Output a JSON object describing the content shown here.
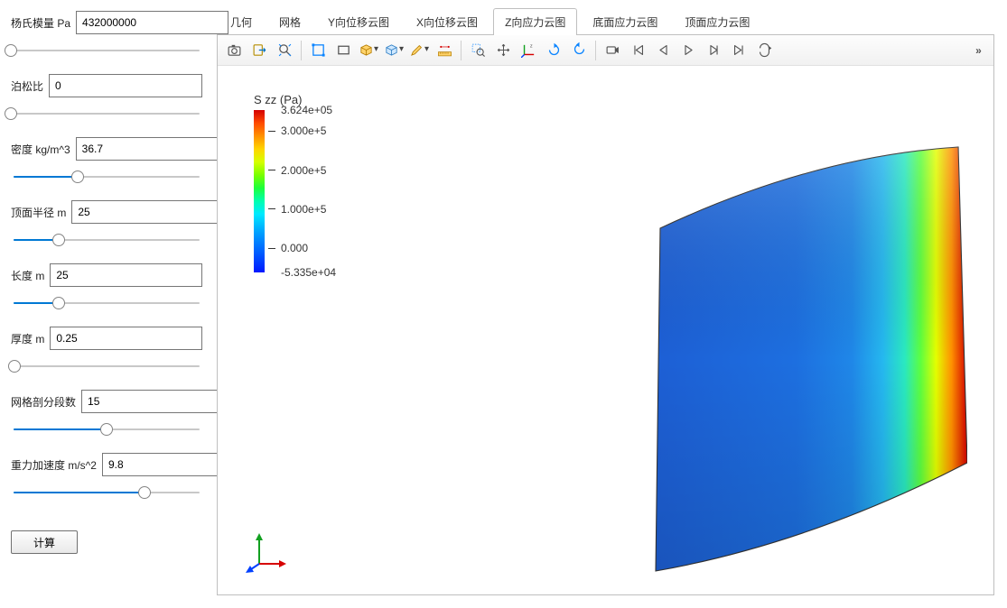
{
  "params": [
    {
      "id": "youngs",
      "label": "杨氏模量 Pa",
      "value": "432000000",
      "pct": 0
    },
    {
      "id": "poisson",
      "label": "泊松比",
      "value": "0",
      "pct": 0
    },
    {
      "id": "density",
      "label": "密度 kg/m^3",
      "value": "36.7",
      "pct": 35
    },
    {
      "id": "radius",
      "label": "顶面半径 m",
      "value": "25",
      "pct": 25
    },
    {
      "id": "length",
      "label": "长度 m",
      "value": "25",
      "pct": 25
    },
    {
      "id": "thick",
      "label": "厚度 m",
      "value": "0.25",
      "pct": 2
    },
    {
      "id": "mesh",
      "label": "网格剖分段数",
      "value": "15",
      "pct": 50
    },
    {
      "id": "grav",
      "label": "重力加速度 m/s^2",
      "value": "9.8",
      "pct": 70
    }
  ],
  "compute_btn": "计算",
  "tabs": [
    {
      "id": "geom",
      "label": "几何",
      "active": false
    },
    {
      "id": "mesh",
      "label": "网格",
      "active": false
    },
    {
      "id": "dispY",
      "label": "Y向位移云图",
      "active": false
    },
    {
      "id": "dispX",
      "label": "X向位移云图",
      "active": false
    },
    {
      "id": "stressZ",
      "label": "Z向应力云图",
      "active": true
    },
    {
      "id": "stressBot",
      "label": "底面应力云图",
      "active": false
    },
    {
      "id": "stressTop",
      "label": "顶面应力云图",
      "active": false
    }
  ],
  "toolbar": {
    "items": [
      {
        "id": "screenshot-icon",
        "kind": "camera"
      },
      {
        "id": "export-icon",
        "kind": "export"
      },
      {
        "id": "zoom-fit-icon",
        "kind": "zoomfit"
      },
      {
        "id": "sep"
      },
      {
        "id": "select-box-icon",
        "kind": "box"
      },
      {
        "id": "select-rect-icon",
        "kind": "rect"
      },
      {
        "id": "cube-dd-icon",
        "kind": "cube",
        "dd": true
      },
      {
        "id": "transparency-icon",
        "kind": "transp",
        "dd": true
      },
      {
        "id": "clear-icon",
        "kind": "brush",
        "dd": true
      },
      {
        "id": "measure-icon",
        "kind": "measure"
      },
      {
        "id": "sep"
      },
      {
        "id": "zoom-window-icon",
        "kind": "zoomwin"
      },
      {
        "id": "pan-icon",
        "kind": "pan"
      },
      {
        "id": "axes-icon",
        "kind": "axes"
      },
      {
        "id": "rotate-ccw-icon",
        "kind": "rot",
        "dir": "ccw"
      },
      {
        "id": "rotate-cw-icon",
        "kind": "rot",
        "dir": "cw"
      },
      {
        "id": "sep"
      },
      {
        "id": "record-icon",
        "kind": "record"
      },
      {
        "id": "frame-first-icon",
        "kind": "first"
      },
      {
        "id": "frame-prev-icon",
        "kind": "prev"
      },
      {
        "id": "play-icon",
        "kind": "play"
      },
      {
        "id": "frame-next-icon",
        "kind": "next"
      },
      {
        "id": "frame-last-icon",
        "kind": "last"
      },
      {
        "id": "loop-icon",
        "kind": "loop"
      }
    ],
    "overflow": "»"
  },
  "legend": {
    "title": "S zz (Pa)",
    "ticks": [
      {
        "pos": 0,
        "label": "3.624e+05",
        "max": true
      },
      {
        "pos": 13,
        "label": "3.000e+5"
      },
      {
        "pos": 37,
        "label": "2.000e+5"
      },
      {
        "pos": 61,
        "label": "1.000e+5"
      },
      {
        "pos": 85,
        "label": "0.000"
      },
      {
        "pos": 100,
        "label": "-5.335e+04",
        "min": true
      }
    ]
  },
  "axis_labels": {
    "x": "x",
    "y": "y",
    "z": "z"
  },
  "accent": "#0078d4"
}
